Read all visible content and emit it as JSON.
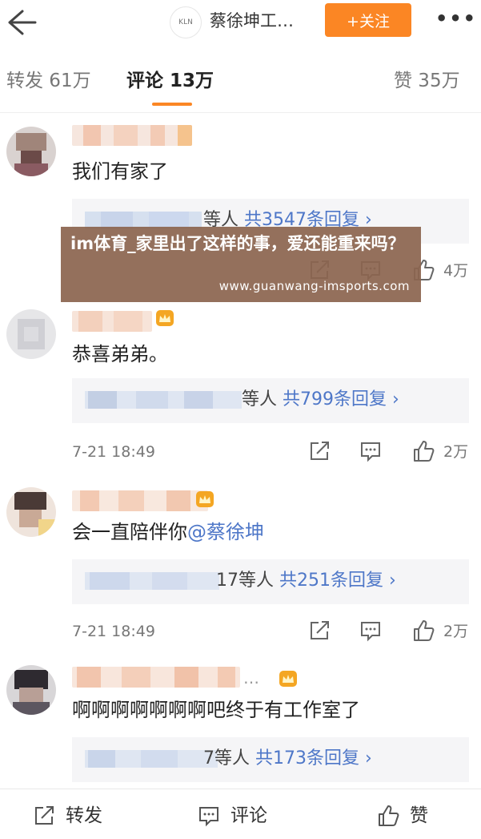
{
  "header": {
    "account_logo_text": "KLN",
    "account_name": "蔡徐坤工…",
    "follow_label": "+关注"
  },
  "tabs": [
    {
      "label": "转发 61万"
    },
    {
      "label": "评论 13万"
    },
    {
      "label": "赞 35万"
    }
  ],
  "overlay": {
    "title": "im体育_家里出了这样的事，爱还能重来吗？",
    "url": "www.guanwang-imsports.com"
  },
  "comments": [
    {
      "text": "我们有家了",
      "reply_suffix": "等人",
      "reply_count": "共3547条回复 ›",
      "likes": "4万"
    },
    {
      "text": "恭喜弟弟。",
      "reply_suffix": "等人",
      "reply_count": "共799条回复 ›",
      "time": "7-21 18:49",
      "likes": "2万"
    },
    {
      "text": "会一直陪伴你",
      "mention": "@蔡徐坤",
      "reply_suffix": "17等人",
      "reply_count": "共251条回复 ›",
      "time": "7-21 18:49",
      "likes": "2万"
    },
    {
      "text": "啊啊啊啊啊啊啊吧终于有工作室了",
      "name_ellipsis": "…",
      "reply_suffix": "7等人",
      "reply_count": "共173条回复 ›"
    }
  ],
  "bottom_bar": {
    "repost_label": "转发",
    "comment_label": "评论",
    "like_label": "赞"
  },
  "colors": {
    "accent": "#fb8624",
    "link": "#4e77c8",
    "overlay": "#8c6550"
  },
  "icons": [
    "back-arrow-icon",
    "more-dots-icon",
    "repost-icon",
    "comment-icon",
    "like-thumb-icon",
    "crown-icon"
  ]
}
